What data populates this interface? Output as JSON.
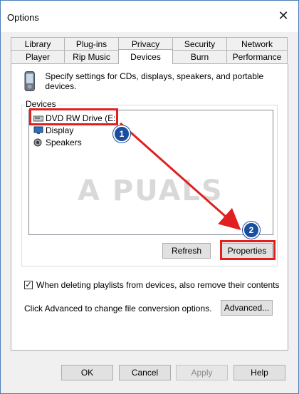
{
  "window": {
    "title": "Options",
    "close_glyph": "✕"
  },
  "tabs": {
    "row1": [
      "Library",
      "Plug-ins",
      "Privacy",
      "Security",
      "Network"
    ],
    "row2": [
      "Player",
      "Rip Music",
      "Devices",
      "Burn",
      "Performance"
    ],
    "active": "Devices"
  },
  "devices_page": {
    "description": "Specify settings for CDs, displays, speakers, and portable devices.",
    "group_label": "Devices",
    "items": [
      {
        "label": "DVD RW Drive (E:)",
        "icon": "dvd-drive-icon"
      },
      {
        "label": "Display",
        "icon": "monitor-icon"
      },
      {
        "label": "Speakers",
        "icon": "speaker-icon"
      }
    ],
    "refresh_label": "Refresh",
    "properties_label": "Properties",
    "checkbox_label": "When deleting playlists from devices, also remove their contents",
    "checkbox_checked": true,
    "checkbox_glyph": "✓",
    "advanced_text": "Click Advanced to change file conversion options.",
    "advanced_label": "Advanced..."
  },
  "footer": {
    "ok": "OK",
    "cancel": "Cancel",
    "apply": "Apply",
    "help": "Help"
  },
  "annotations": {
    "step1": "1",
    "step2": "2",
    "highlight_color": "#e02020",
    "badge_color": "#1a4fa0"
  },
  "watermark": "A  PUALS"
}
